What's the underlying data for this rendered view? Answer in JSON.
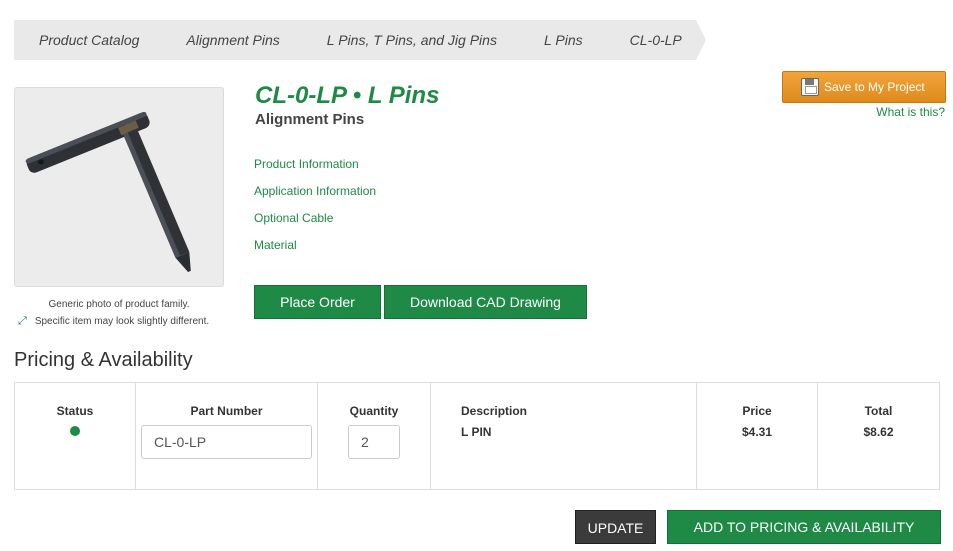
{
  "breadcrumb": [
    "Product Catalog",
    "Alignment Pins",
    "L Pins, T Pins, and Jig Pins",
    "L Pins",
    "CL-0-LP"
  ],
  "product": {
    "title": "CL-0-LP  •  L Pins",
    "subtitle": "Alignment Pins",
    "links": [
      "Product Information",
      "Application Information",
      "Optional Cable",
      "Material"
    ],
    "caption_line1": "Generic photo of product family.",
    "caption_line2": "Specific item may look slightly different.",
    "place_order": "Place Order",
    "download_cad": "Download CAD Drawing"
  },
  "project": {
    "save_label": "Save to My Project",
    "what_is_this": "What is this?"
  },
  "pricing": {
    "title": "Pricing & Availability",
    "headers": {
      "status": "Status",
      "part_number": "Part Number",
      "quantity": "Quantity",
      "description": "Description",
      "price": "Price",
      "total": "Total"
    },
    "row": {
      "status": "available",
      "part_number": "CL-0-LP",
      "quantity": "2",
      "description": "L PIN",
      "price": "$4.31",
      "total": "$8.62"
    },
    "update_label": "UPDATE",
    "add_label": "ADD TO PRICING & AVAILABILITY"
  },
  "colors": {
    "brand_green": "#1e8a45",
    "orange": "#e8951f",
    "breadcrumb_bg": "#e9e9e9"
  }
}
